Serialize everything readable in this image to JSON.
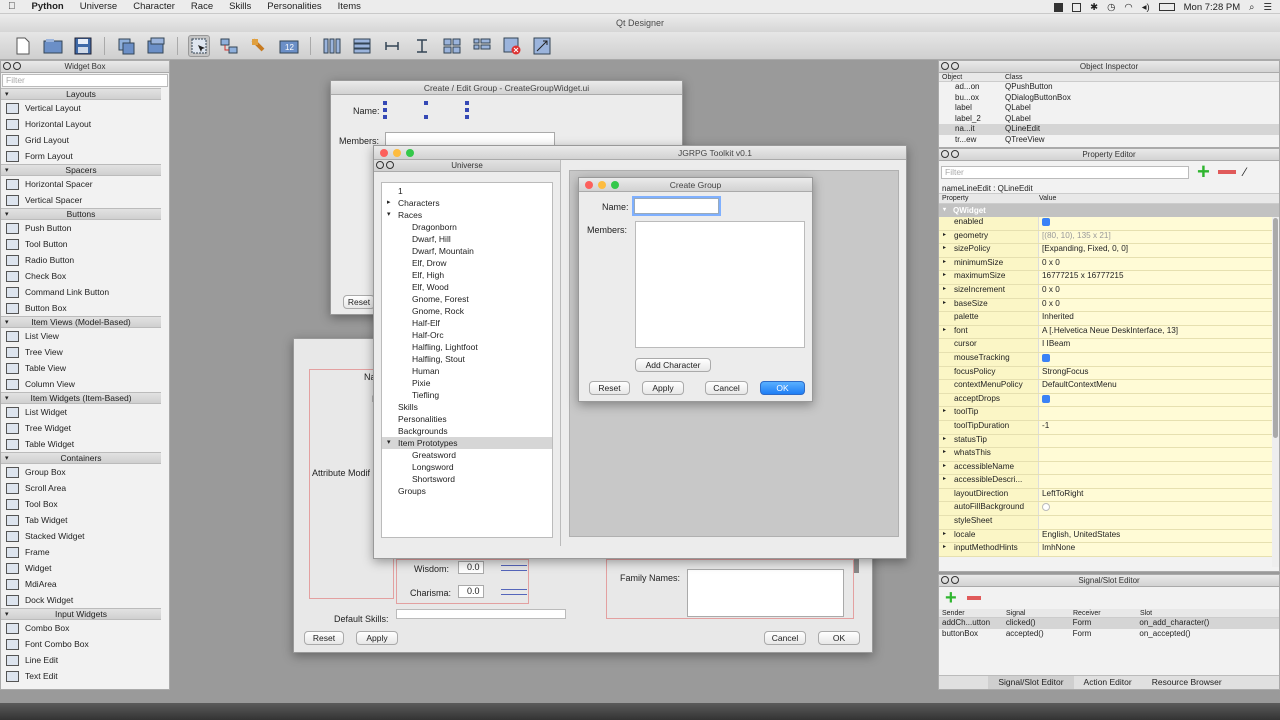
{
  "menubar": {
    "apple": "",
    "app": "Python",
    "items": [
      "Universe",
      "Character",
      "Race",
      "Skills",
      "Personalities",
      "Items"
    ],
    "clock": "Mon 7:28 PM"
  },
  "designer": {
    "title": "Qt Designer"
  },
  "widget_box": {
    "title": "Widget Box",
    "filter_placeholder": "Filter",
    "categories": [
      {
        "name": "Layouts",
        "items": [
          "Vertical Layout",
          "Horizontal Layout",
          "Grid Layout",
          "Form Layout"
        ]
      },
      {
        "name": "Spacers",
        "items": [
          "Horizontal Spacer",
          "Vertical Spacer"
        ]
      },
      {
        "name": "Buttons",
        "items": [
          "Push Button",
          "Tool Button",
          "Radio Button",
          "Check Box",
          "Command Link Button",
          "Button Box"
        ]
      },
      {
        "name": "Item Views (Model-Based)",
        "items": [
          "List View",
          "Tree View",
          "Table View",
          "Column View"
        ]
      },
      {
        "name": "Item Widgets (Item-Based)",
        "items": [
          "List Widget",
          "Tree Widget",
          "Table Widget"
        ]
      },
      {
        "name": "Containers",
        "items": [
          "Group Box",
          "Scroll Area",
          "Tool Box",
          "Tab Widget",
          "Stacked Widget",
          "Frame",
          "Widget",
          "MdiArea",
          "Dock Widget"
        ]
      },
      {
        "name": "Input Widgets",
        "items": [
          "Combo Box",
          "Font Combo Box",
          "Line Edit",
          "Text Edit"
        ]
      }
    ]
  },
  "form_window": {
    "title": "Create / Edit Group - CreateGroupWidget.ui",
    "name_label": "Name:",
    "members_label": "Members:",
    "reset_label": "Reset"
  },
  "char_form": {
    "partial_label_1": "Na",
    "partial_label_2": "D",
    "attr_label": "Attribute Modif",
    "wisdom_label": "Wisdom:",
    "wisdom_value": "0.0",
    "charisma_label": "Charisma:",
    "charisma_value": "0.0",
    "family_label": "Family Names:",
    "default_skills_label": "Default Skills:",
    "reset_label": "Reset",
    "apply_label": "Apply",
    "cancel_label": "Cancel",
    "ok_label": "OK"
  },
  "toolkit": {
    "title": "JGRPG Toolkit v0.1",
    "universe_title": "Universe",
    "tree": [
      {
        "label": "1",
        "level": 0,
        "exp": ""
      },
      {
        "label": "Characters",
        "level": 0,
        "exp": "▸"
      },
      {
        "label": "Races",
        "level": 0,
        "exp": "▾"
      },
      {
        "label": "Dragonborn",
        "level": 1,
        "exp": ""
      },
      {
        "label": "Dwarf, Hill",
        "level": 1,
        "exp": ""
      },
      {
        "label": "Dwarf, Mountain",
        "level": 1,
        "exp": ""
      },
      {
        "label": "Elf, Drow",
        "level": 1,
        "exp": ""
      },
      {
        "label": "Elf, High",
        "level": 1,
        "exp": ""
      },
      {
        "label": "Elf, Wood",
        "level": 1,
        "exp": ""
      },
      {
        "label": "Gnome, Forest",
        "level": 1,
        "exp": ""
      },
      {
        "label": "Gnome, Rock",
        "level": 1,
        "exp": ""
      },
      {
        "label": "Half-Elf",
        "level": 1,
        "exp": ""
      },
      {
        "label": "Half-Orc",
        "level": 1,
        "exp": ""
      },
      {
        "label": "Halfling, Lightfoot",
        "level": 1,
        "exp": ""
      },
      {
        "label": "Halfling, Stout",
        "level": 1,
        "exp": ""
      },
      {
        "label": "Human",
        "level": 1,
        "exp": ""
      },
      {
        "label": "Pixie",
        "level": 1,
        "exp": ""
      },
      {
        "label": "Tiefling",
        "level": 1,
        "exp": ""
      },
      {
        "label": "Skills",
        "level": 0,
        "exp": ""
      },
      {
        "label": "Personalities",
        "level": 0,
        "exp": ""
      },
      {
        "label": "Backgrounds",
        "level": 0,
        "exp": ""
      },
      {
        "label": "Item Prototypes",
        "level": 0,
        "exp": "▾",
        "selected": true
      },
      {
        "label": "Greatsword",
        "level": 1,
        "exp": ""
      },
      {
        "label": "Longsword",
        "level": 1,
        "exp": ""
      },
      {
        "label": "Shortsword",
        "level": 1,
        "exp": ""
      },
      {
        "label": "Groups",
        "level": 0,
        "exp": ""
      }
    ]
  },
  "create_group": {
    "title": "Create Group",
    "name_label": "Name:",
    "name_value": "",
    "members_label": "Members:",
    "add_character_label": "Add Character",
    "reset_label": "Reset",
    "apply_label": "Apply",
    "cancel_label": "Cancel",
    "ok_label": "OK"
  },
  "object_inspector": {
    "title": "Object Inspector",
    "col_object": "Object",
    "col_class": "Class",
    "rows": [
      {
        "object": "ad...on",
        "class": "QPushButton"
      },
      {
        "object": "bu...ox",
        "class": "QDialogButtonBox"
      },
      {
        "object": "label",
        "class": "QLabel"
      },
      {
        "object": "label_2",
        "class": "QLabel"
      },
      {
        "object": "na...it",
        "class": "QLineEdit",
        "selected": true
      },
      {
        "object": "tr...ew",
        "class": "QTreeView"
      }
    ]
  },
  "property_editor": {
    "title": "Property Editor",
    "filter_placeholder": "Filter",
    "object_label": "nameLineEdit : QLineEdit",
    "col_property": "Property",
    "col_value": "Value",
    "section": "QWidget",
    "rows": [
      {
        "name": "enabled",
        "value": "",
        "check": "on",
        "exp": ""
      },
      {
        "name": "geometry",
        "value": "[(80, 10), 135 x 21]",
        "exp": "▸",
        "gray": true
      },
      {
        "name": "sizePolicy",
        "value": "[Expanding, Fixed, 0, 0]",
        "exp": "▸"
      },
      {
        "name": "minimumSize",
        "value": "0 x 0",
        "exp": "▸"
      },
      {
        "name": "maximumSize",
        "value": "16777215 x 16777215",
        "exp": "▸"
      },
      {
        "name": "sizeIncrement",
        "value": "0 x 0",
        "exp": "▸"
      },
      {
        "name": "baseSize",
        "value": "0 x 0",
        "exp": "▸"
      },
      {
        "name": "palette",
        "value": "Inherited",
        "exp": ""
      },
      {
        "name": "font",
        "value": "A  [.Helvetica Neue DeskInterface, 13]",
        "exp": "▸"
      },
      {
        "name": "cursor",
        "value": "I  IBeam",
        "exp": ""
      },
      {
        "name": "mouseTracking",
        "value": "",
        "check": "on",
        "exp": ""
      },
      {
        "name": "focusPolicy",
        "value": "StrongFocus",
        "exp": ""
      },
      {
        "name": "contextMenuPolicy",
        "value": "DefaultContextMenu",
        "exp": ""
      },
      {
        "name": "acceptDrops",
        "value": "",
        "check": "on",
        "exp": ""
      },
      {
        "name": "toolTip",
        "value": "",
        "exp": "▸"
      },
      {
        "name": "toolTipDuration",
        "value": "-1",
        "exp": ""
      },
      {
        "name": "statusTip",
        "value": "",
        "exp": "▸"
      },
      {
        "name": "whatsThis",
        "value": "",
        "exp": "▸"
      },
      {
        "name": "accessibleName",
        "value": "",
        "exp": "▸"
      },
      {
        "name": "accessibleDescri...",
        "value": "",
        "exp": "▸"
      },
      {
        "name": "layoutDirection",
        "value": "LeftToRight",
        "exp": ""
      },
      {
        "name": "autoFillBackground",
        "value": "",
        "check": "off",
        "exp": ""
      },
      {
        "name": "styleSheet",
        "value": "",
        "exp": ""
      },
      {
        "name": "locale",
        "value": "English, UnitedStates",
        "exp": "▸"
      },
      {
        "name": "inputMethodHints",
        "value": "ImhNone",
        "exp": "▸"
      }
    ]
  },
  "signal_slot": {
    "title": "Signal/Slot Editor",
    "col_sender": "Sender",
    "col_signal": "Signal",
    "col_receiver": "Receiver",
    "col_slot": "Slot",
    "rows": [
      {
        "sender": "addCh...utton",
        "signal": "clicked()",
        "receiver": "Form",
        "slot": "on_add_character()",
        "selected": true
      },
      {
        "sender": "buttonBox",
        "signal": "accepted()",
        "receiver": "Form",
        "slot": "on_accepted()"
      }
    ],
    "tabs": [
      "Signal/Slot Editor",
      "Action Editor",
      "Resource Browser"
    ]
  },
  "colors": {
    "close": "#fc605c",
    "minimize": "#fdbc40",
    "zoom": "#34c84a",
    "accent": "#1f7ef5",
    "property_bg": "#fffbd6",
    "green_plus": "#2fb52f",
    "red_minus": "#e05a5a"
  }
}
